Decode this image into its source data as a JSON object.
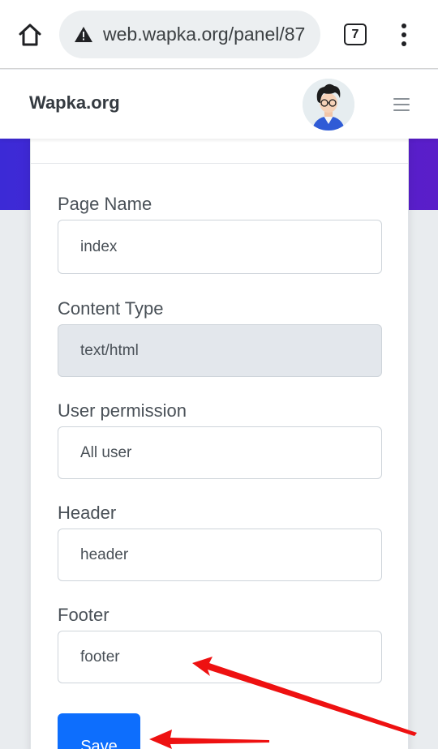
{
  "browser": {
    "url": "web.wapka.org/panel/87",
    "tab_count": "7"
  },
  "navbar": {
    "brand": "Wapka.org"
  },
  "form": {
    "page_name": {
      "label": "Page Name",
      "value": "index"
    },
    "content_type": {
      "label": "Content Type",
      "value": "text/html"
    },
    "user_permission": {
      "label": "User permission",
      "value": "All user"
    },
    "header": {
      "label": "Header",
      "value": "header"
    },
    "footer": {
      "label": "Footer",
      "value": "footer"
    },
    "save_label": "Save"
  },
  "colors": {
    "primary": "#0d6efd",
    "hero_gradient_start": "#3c2ad6",
    "hero_gradient_end": "#5a1ec9",
    "annotation_arrow": "#ee1111"
  }
}
